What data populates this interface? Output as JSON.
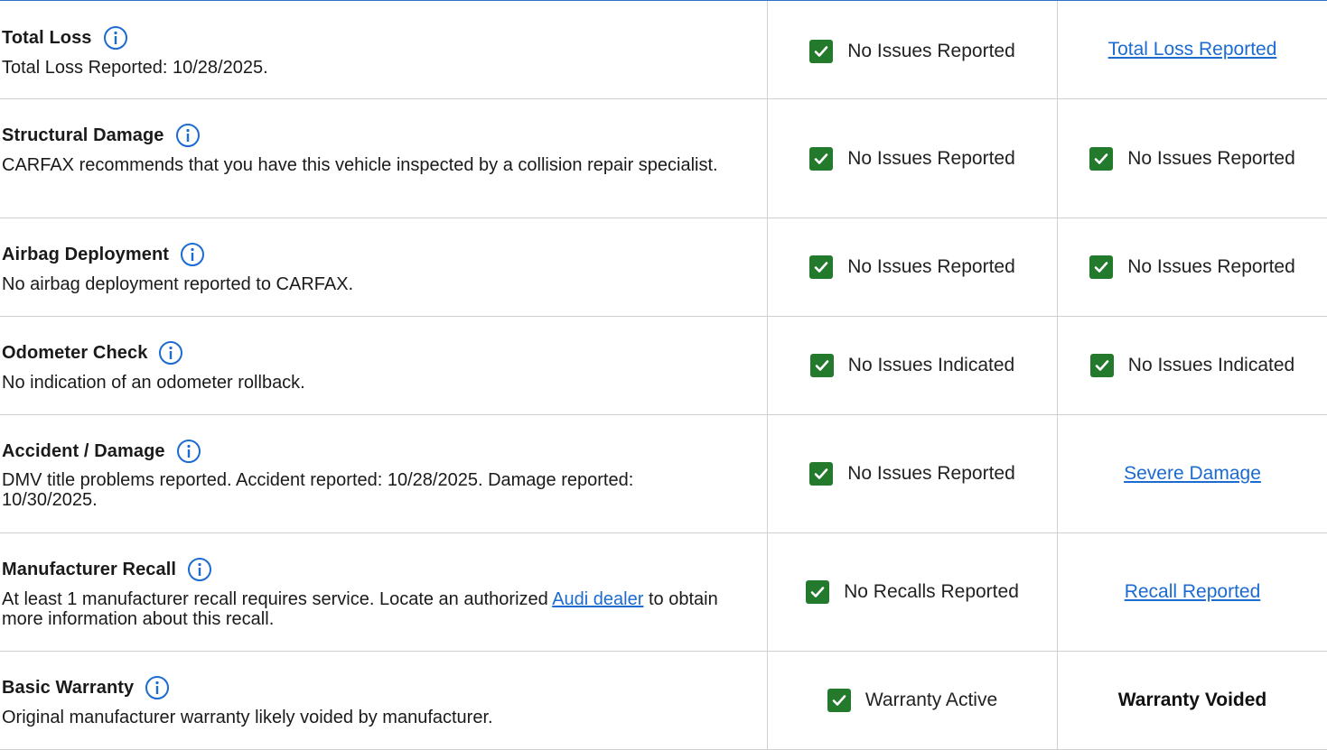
{
  "rows": [
    {
      "title": "Total Loss",
      "description": "Total Loss Reported: 10/28/2025.",
      "col_b": {
        "text": "No Issues Reported",
        "checked": true
      },
      "col_c": {
        "type": "link",
        "text": "Total Loss Reported"
      }
    },
    {
      "title": "Structural Damage",
      "description": "CARFAX recommends that you have this vehicle inspected by a collision repair specialist.",
      "col_b": {
        "text": "No Issues Reported",
        "checked": true
      },
      "col_c": {
        "type": "check",
        "text": "No Issues Reported"
      }
    },
    {
      "title": "Airbag Deployment",
      "description": "No airbag deployment reported to CARFAX.",
      "col_b": {
        "text": "No Issues Reported",
        "checked": true
      },
      "col_c": {
        "type": "check",
        "text": "No Issues Reported"
      }
    },
    {
      "title": "Odometer Check",
      "description": "No indication of an odometer rollback.",
      "col_b": {
        "text": "No Issues Indicated",
        "checked": true
      },
      "col_c": {
        "type": "check",
        "text": "No Issues Indicated"
      }
    },
    {
      "title": "Accident / Damage",
      "description": "DMV title problems reported. Accident reported: 10/28/2025. Damage reported: 10/30/2025.",
      "col_b": {
        "text": "No Issues Reported",
        "checked": true
      },
      "col_c": {
        "type": "link",
        "text": "Severe Damage"
      }
    },
    {
      "title": "Manufacturer Recall",
      "description_before": "At least 1 manufacturer recall requires service. Locate an authorized ",
      "description_link": "Audi dealer",
      "description_after": " to obtain more information about this recall.",
      "col_b": {
        "text": "No Recalls Reported",
        "checked": true
      },
      "col_c": {
        "type": "link",
        "text": "Recall Reported"
      }
    },
    {
      "title": "Basic Warranty",
      "description": "Original manufacturer warranty likely voided by manufacturer.",
      "col_b": {
        "text": "Warranty Active",
        "checked": true
      },
      "col_c": {
        "type": "bold",
        "text": "Warranty Voided"
      }
    }
  ],
  "colors": {
    "accent": "#1b6bd1",
    "check": "#237a2c",
    "border": "#d0d0d0"
  },
  "icons": {
    "info": "info-circle-icon",
    "check": "checkbox-check-icon"
  }
}
